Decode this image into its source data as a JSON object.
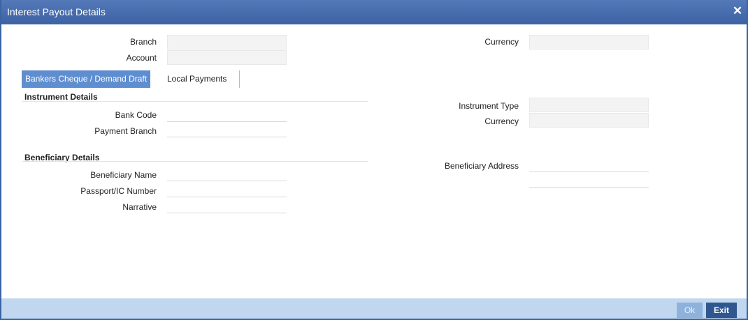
{
  "window": {
    "title": "Interest Payout Details",
    "close_glyph": "✕"
  },
  "header": {
    "branch_label": "Branch",
    "account_label": "Account",
    "currency_label": "Currency",
    "branch_value": "",
    "account_value": "",
    "currency_value": ""
  },
  "tabs": [
    {
      "label": "Bankers Cheque / Demand Draft",
      "active": true
    },
    {
      "label": "Local Payments",
      "active": false
    }
  ],
  "instrument": {
    "heading": "Instrument Details",
    "bank_code_label": "Bank Code",
    "payment_branch_label": "Payment Branch",
    "instrument_type_label": "Instrument Type",
    "currency_label": "Currency",
    "bank_code_value": "",
    "payment_branch_value": "",
    "instrument_type_value": "",
    "currency_value": ""
  },
  "beneficiary": {
    "heading": "Beneficiary Details",
    "name_label": "Beneficiary Name",
    "passport_label": "Passport/IC Number",
    "narrative_label": "Narrative",
    "address_label": "Beneficiary Address",
    "name_value": "",
    "passport_value": "",
    "narrative_value": "",
    "address_line1": "",
    "address_line2": ""
  },
  "footer": {
    "ok_label": "Ok",
    "exit_label": "Exit"
  },
  "colors": {
    "titlebar": "#3d62a4",
    "active_tab": "#5f8ed0",
    "footer": "#c1d7ef",
    "exit_button": "#2f578f",
    "ok_button": "#8fb2dd"
  }
}
